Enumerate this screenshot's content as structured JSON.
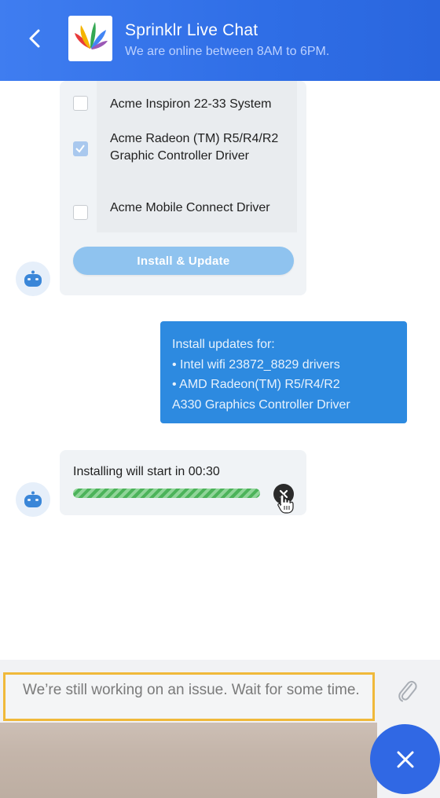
{
  "header": {
    "title": "Sprinklr Live Chat",
    "subtitle": "We are online between 8AM to 6PM."
  },
  "drivers": [
    {
      "label": "Acme Inspiron 22-33 System",
      "checked": false
    },
    {
      "label": "Acme Radeon (TM) R5/R4/R2 Graphic Controller Driver",
      "checked": true
    },
    {
      "label": "Acme Mobile Connect Driver",
      "checked": false
    }
  ],
  "install_button": "Install & Update",
  "user_message": {
    "line1": "Install updates for:",
    "line2": "• Intel wifi 23872_8829 drivers",
    "line3": "• AMD Radeon(TM) R5/R4/R2",
    "line4": "A330 Graphics Controller Driver"
  },
  "progress": {
    "text": "Installing will start in 00:30",
    "fraction": 1.0
  },
  "input": {
    "value": "We’re still working on an issue. Wait for some time."
  },
  "colors": {
    "header": "#2f6ee6",
    "user_bubble": "#2d8ae0",
    "input_highlight": "#f0b93a",
    "progress": "#4cb35a",
    "fab": "#3068e4"
  },
  "icons": [
    "back-arrow-icon",
    "sprinklr-logo",
    "bot-icon",
    "close-icon",
    "hand-cursor-icon",
    "paperclip-icon"
  ]
}
